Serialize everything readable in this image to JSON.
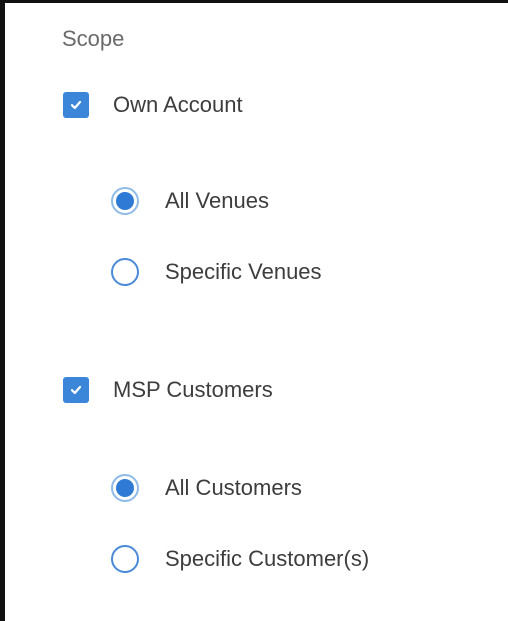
{
  "scope": {
    "label": "Scope",
    "groups": [
      {
        "checkbox_label": "Own Account",
        "checked": true,
        "options": [
          {
            "label": "All Venues",
            "selected": true
          },
          {
            "label": "Specific Venues",
            "selected": false
          }
        ]
      },
      {
        "checkbox_label": "MSP Customers",
        "checked": true,
        "options": [
          {
            "label": "All Customers",
            "selected": true
          },
          {
            "label": "Specific Customer(s)",
            "selected": false
          }
        ]
      }
    ]
  },
  "icons": {
    "checkbox_checked": "check-icon",
    "radio_selected": "radio-dot-icon"
  },
  "colors": {
    "accent": "#3b86d9",
    "radio_border": "#4a8ad8",
    "text": "#3d3d3d",
    "label_muted": "#6a6a6a"
  }
}
